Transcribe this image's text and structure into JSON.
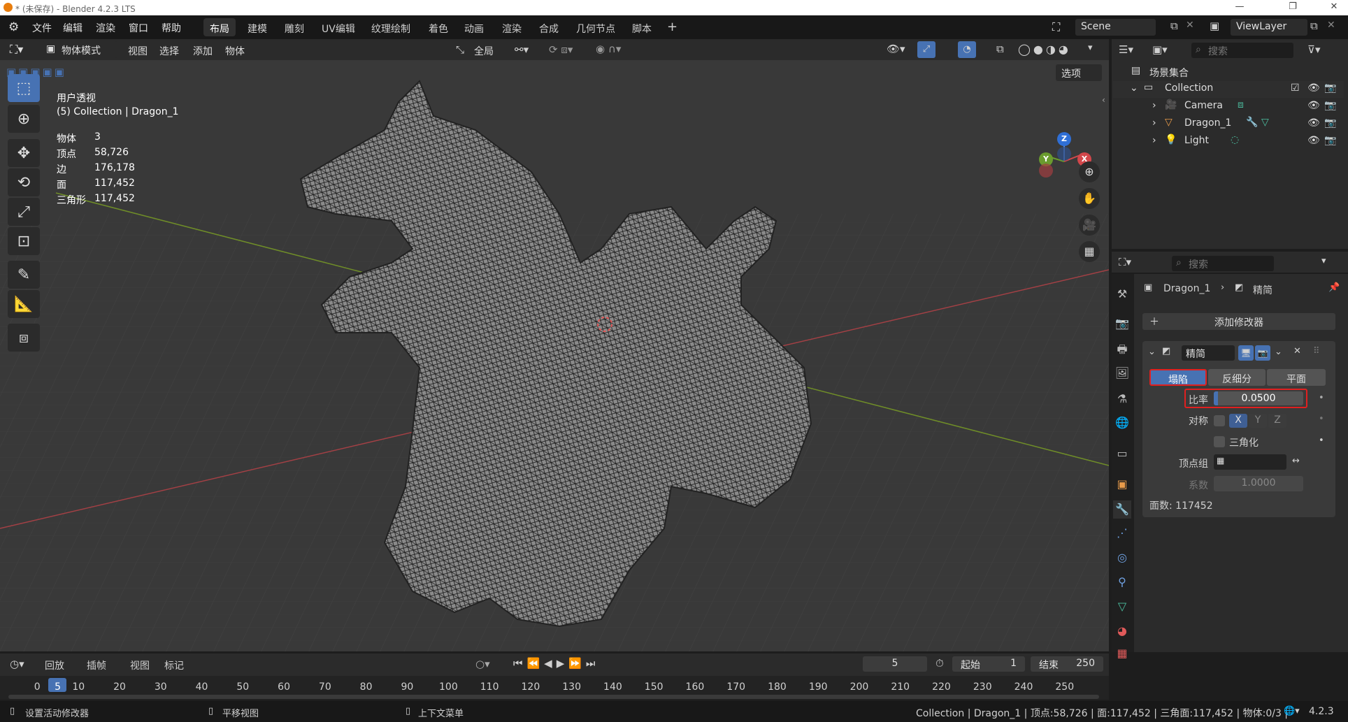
{
  "app": {
    "title": "* (未保存) - Blender 4.2.3 LTS"
  },
  "menu": {
    "items": [
      "文件",
      "编辑",
      "渲染",
      "窗口",
      "帮助"
    ]
  },
  "workspaces": [
    "布局",
    "建模",
    "雕刻",
    "UV编辑",
    "纹理绘制",
    "着色",
    "动画",
    "渲染",
    "合成",
    "几何节点",
    "脚本"
  ],
  "active_workspace": "布局",
  "scene": {
    "label": "Scene",
    "viewlayer": "ViewLayer"
  },
  "viewport_header": {
    "mode": "物体模式",
    "menus": [
      "视图",
      "选择",
      "添加",
      "物体"
    ],
    "transform": "全局",
    "options": "选项"
  },
  "overlay": {
    "view_name": "用户透视",
    "collection_line": "(5) Collection | Dragon_1",
    "stats": [
      {
        "k": "物体",
        "v": "3"
      },
      {
        "k": "顶点",
        "v": "58,726"
      },
      {
        "k": "边",
        "v": "176,178"
      },
      {
        "k": "面",
        "v": "117,452"
      },
      {
        "k": "三角形",
        "v": "117,452"
      }
    ]
  },
  "gizmo": {
    "x": "X",
    "y": "Y",
    "z": "Z"
  },
  "outliner": {
    "search": "搜索",
    "root": "场景集合",
    "collection": "Collection",
    "items": [
      {
        "name": "Camera",
        "icon": "camera-icon"
      },
      {
        "name": "Dragon_1",
        "icon": "mesh-icon"
      },
      {
        "name": "Light",
        "icon": "light-icon"
      }
    ]
  },
  "properties": {
    "search": "搜索",
    "breadcrumb_object": "Dragon_1",
    "breadcrumb_mod": "精简",
    "add_modifier": "添加修改器",
    "modifier": {
      "name": "精简",
      "modes": [
        "塌陷",
        "反细分",
        "平面"
      ],
      "active_mode": "塌陷",
      "ratio_label": "比率",
      "ratio": "0.0500",
      "ratio_fraction": 0.05,
      "sym_label": "对称",
      "axes": [
        "X",
        "Y",
        "Z"
      ],
      "tri_label": "三角化",
      "vgroup_label": "顶点组",
      "factor_label": "系数",
      "factor": "1.0000",
      "face_count": "面数: 117452"
    }
  },
  "timeline": {
    "menus": [
      "回放",
      "插帧",
      "视图",
      "标记"
    ],
    "current": "5",
    "start_label": "起始",
    "start": "1",
    "end_label": "结束",
    "end": "250",
    "ticks": [
      "0",
      "5",
      "10",
      "20",
      "30",
      "40",
      "50",
      "60",
      "70",
      "80",
      "90",
      "100",
      "110",
      "120",
      "130",
      "140",
      "150",
      "160",
      "170",
      "180",
      "190",
      "200",
      "210",
      "220",
      "230",
      "240",
      "250"
    ]
  },
  "statusbar": {
    "left1": "设置活动修改器",
    "left2": "平移视图",
    "left3": "上下文菜单",
    "right": "Collection | Dragon_1 | 顶点:58,726 | 面:117,452 | 三角面:117,452 | 物体:0/3 |",
    "version": "4.2.3"
  }
}
